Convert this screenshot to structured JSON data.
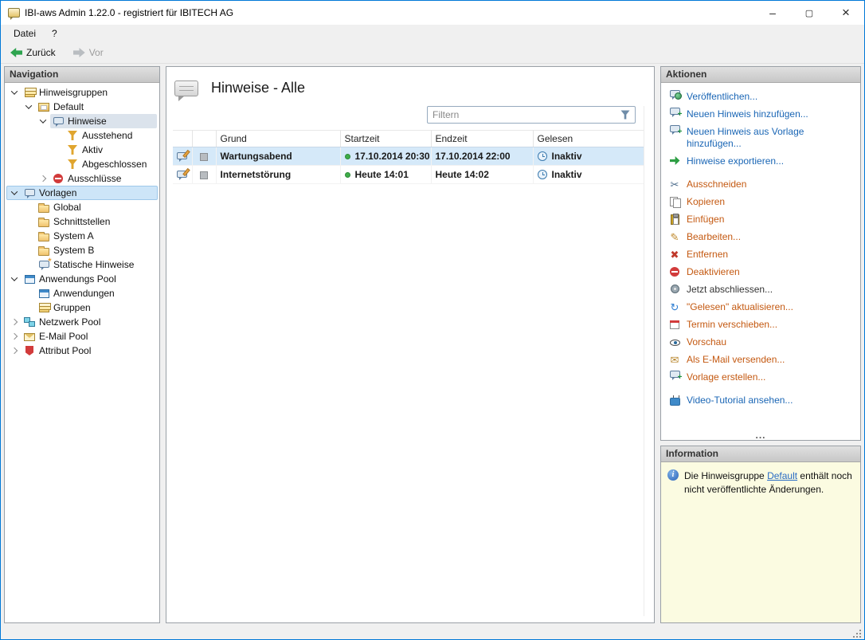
{
  "window": {
    "title": "IBI-aws Admin 1.22.0 - registriert für IBITECH AG",
    "minimize_label": "–",
    "maximize_label": "▢",
    "close_label": "×"
  },
  "colors": {
    "accent_border": "#0078d7",
    "link_blue": "#1a66b5",
    "link_orange": "#c45911",
    "selection_blue": "#d5e9f9",
    "info_background": "#fbfbe1",
    "status_green": "#3fae49"
  },
  "menubar": {
    "items": [
      {
        "label": "Datei"
      },
      {
        "label": "?"
      }
    ]
  },
  "toolbar": {
    "back_label": "Zurück",
    "back_icon": "green-left-arrow-icon",
    "forward_label": "Vor",
    "forward_icon": "gray-right-arrow-icon"
  },
  "navigation": {
    "header": "Navigation",
    "tree": [
      {
        "label": "Hinweisgruppen",
        "level": 0,
        "expander": "expanded",
        "icon": "hint-groups-icon"
      },
      {
        "label": "Default",
        "level": 1,
        "expander": "expanded",
        "icon": "hint-group-icon"
      },
      {
        "label": "Hinweise",
        "level": 2,
        "expander": "expanded",
        "icon": "hints-icon",
        "selected": "inactive"
      },
      {
        "label": "Ausstehend",
        "level": 3,
        "expander": "none",
        "icon": "filter-pending-icon"
      },
      {
        "label": "Aktiv",
        "level": 3,
        "expander": "none",
        "icon": "filter-active-icon"
      },
      {
        "label": "Abgeschlossen",
        "level": 3,
        "expander": "none",
        "icon": "filter-completed-icon"
      },
      {
        "label": "Ausschlüsse",
        "level": 2,
        "expander": "collapsed",
        "icon": "exclusions-icon"
      },
      {
        "label": "Vorlagen",
        "level": 0,
        "expander": "expanded",
        "icon": "templates-icon",
        "selected": "active"
      },
      {
        "label": "Global",
        "level": 1,
        "expander": "none",
        "icon": "folder-icon"
      },
      {
        "label": "Schnittstellen",
        "level": 1,
        "expander": "none",
        "icon": "folder-icon"
      },
      {
        "label": "System A",
        "level": 1,
        "expander": "none",
        "icon": "folder-icon"
      },
      {
        "label": "System B",
        "level": 1,
        "expander": "none",
        "icon": "folder-icon"
      },
      {
        "label": "Statische Hinweise",
        "level": 1,
        "expander": "none",
        "icon": "static-hints-icon"
      },
      {
        "label": "Anwendungs Pool",
        "level": 0,
        "expander": "expanded",
        "icon": "application-pool-icon"
      },
      {
        "label": "Anwendungen",
        "level": 1,
        "expander": "none",
        "icon": "applications-icon"
      },
      {
        "label": "Gruppen",
        "level": 1,
        "expander": "none",
        "icon": "groups-icon"
      },
      {
        "label": "Netzwerk Pool",
        "level": 0,
        "expander": "collapsed",
        "icon": "network-pool-icon"
      },
      {
        "label": "E-Mail Pool",
        "level": 0,
        "expander": "collapsed",
        "icon": "email-pool-icon"
      },
      {
        "label": "Attribut Pool",
        "level": 0,
        "expander": "collapsed",
        "icon": "attribute-pool-icon"
      }
    ]
  },
  "main": {
    "title": "Hinweise - Alle",
    "title_icon": "hints-bubble-icon",
    "filter_placeholder": "Filtern",
    "filter_icon": "filter-funnel-icon",
    "table": {
      "columns": [
        "",
        "",
        "Grund",
        "Startzeit",
        "Endzeit",
        "Gelesen"
      ],
      "row_icons": {
        "hint": "hint-bubble-icon",
        "state": "gray-square-icon",
        "start": "green-dot-icon",
        "gelesen": "clock-icon"
      },
      "rows": [
        {
          "grund": "Wartungsabend",
          "startzeit": "17.10.2014 20:30",
          "endzeit": "17.10.2014 22:00",
          "gelesen": "Inaktiv",
          "selected": true
        },
        {
          "grund": "Internetstörung",
          "startzeit": "Heute 14:01",
          "endzeit": "Heute 14:02",
          "gelesen": "Inaktiv",
          "selected": false
        }
      ]
    }
  },
  "actions": {
    "header": "Aktionen",
    "overflow_indicator": "...",
    "items": [
      {
        "label": "Veröffentlichen...",
        "color": "blue",
        "icon": "publish-icon"
      },
      {
        "label": "Neuen Hinweis hinzufügen...",
        "color": "blue",
        "icon": "add-hint-icon"
      },
      {
        "label": "Neuen Hinweis aus Vorlage hinzufügen...",
        "color": "blue",
        "icon": "add-hint-from-template-icon"
      },
      {
        "label": "Hinweise exportieren...",
        "color": "blue",
        "icon": "export-hints-icon"
      },
      {
        "label": "Ausschneiden",
        "color": "orange",
        "icon": "cut-icon",
        "group_start": true
      },
      {
        "label": "Kopieren",
        "color": "orange",
        "icon": "copy-icon"
      },
      {
        "label": "Einfügen",
        "color": "orange",
        "icon": "paste-icon"
      },
      {
        "label": "Bearbeiten...",
        "color": "orange",
        "icon": "edit-icon"
      },
      {
        "label": "Entfernen",
        "color": "orange",
        "icon": "remove-icon"
      },
      {
        "label": "Deaktivieren",
        "color": "orange",
        "icon": "deactivate-icon"
      },
      {
        "label": "Jetzt abschliessen...",
        "color": "dark",
        "icon": "finish-now-icon"
      },
      {
        "label": "\"Gelesen\" aktualisieren...",
        "color": "orange",
        "icon": "refresh-read-icon"
      },
      {
        "label": "Termin verschieben...",
        "color": "orange",
        "icon": "reschedule-icon"
      },
      {
        "label": "Vorschau",
        "color": "orange",
        "icon": "preview-icon"
      },
      {
        "label": "Als E-Mail versenden...",
        "color": "orange",
        "icon": "send-email-icon"
      },
      {
        "label": "Vorlage erstellen...",
        "color": "orange",
        "icon": "create-template-icon"
      },
      {
        "label": "Video-Tutorial ansehen...",
        "color": "blue",
        "icon": "video-icon",
        "group_start": true
      }
    ]
  },
  "information": {
    "header": "Information",
    "icon": "info-circle-icon",
    "text_before": "Die Hinweisgruppe ",
    "link_label": "Default",
    "text_after": " enthält noch nicht veröffentlichte Änderungen."
  }
}
